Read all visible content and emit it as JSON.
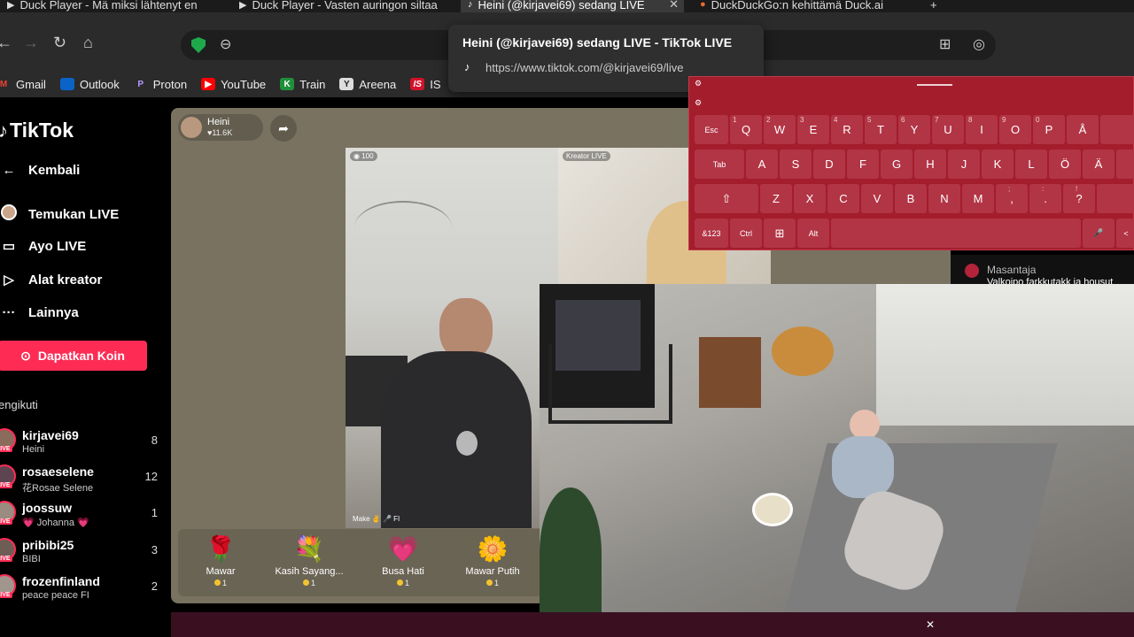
{
  "tabs": [
    {
      "icon": "▶",
      "title": "Duck Player - Mä miksi lähtenyt en"
    },
    {
      "icon": "▶",
      "title": "Duck Player - Vasten auringon siltaa"
    },
    {
      "icon": "♪",
      "title": "Heini (@kirjavei69) sedang LIVE"
    },
    {
      "icon": "●",
      "title": "DuckDuckGo:n kehittämä Duck.ai"
    }
  ],
  "tooltip": {
    "title": "Heini (@kirjavei69) sedang LIVE - TikTok LIVE",
    "url": "https://www.tiktok.com/@kirjavei69/live"
  },
  "bookmarks": [
    {
      "label": "Gmail",
      "icon": "M",
      "color": "#ea4335"
    },
    {
      "label": "Outlook",
      "icon": "■",
      "color": "#0a64c8"
    },
    {
      "label": "Proton",
      "icon": "P",
      "color": "#6d4aff"
    },
    {
      "label": "YouTube",
      "icon": "▶",
      "color": "#ff0000"
    },
    {
      "label": "Train",
      "icon": "K",
      "color": "#1f8f3a"
    },
    {
      "label": "Areena",
      "icon": "Y",
      "color": "#444444"
    },
    {
      "label": "IS",
      "icon": "IS",
      "color": "#d4112a"
    }
  ],
  "sidebar": {
    "logo": "TikTok",
    "nav": [
      {
        "label": "Kembali"
      },
      {
        "label": "Temukan LIVE"
      },
      {
        "label": "Ayo LIVE"
      },
      {
        "label": "Alat kreator"
      },
      {
        "label": "Lainnya"
      }
    ],
    "coin_button": "Dapatkan Koin",
    "following_title": "engikuti",
    "following": [
      {
        "name": "kirjavei69",
        "sub": "Heini",
        "count": "8"
      },
      {
        "name": "rosaeselene",
        "sub": "花Rosae Selene",
        "count": "12"
      },
      {
        "name": "joossuw",
        "sub": "💗 Johanna 💗",
        "count": "1"
      },
      {
        "name": "pribibi25",
        "sub": "BIBI",
        "count": "3"
      },
      {
        "name": "frozenfinland",
        "sub": "peace peace FI",
        "count": "2"
      }
    ]
  },
  "live": {
    "host_name": "Heini",
    "host_likes": "♥11.6K",
    "cam1_tag": "100",
    "cam1_caption": "Make ✌ 🎤 FI",
    "cam2_tag": "Kreator LIVE",
    "gifts": [
      {
        "name": "Mawar",
        "cost": "1",
        "icon": "🌹"
      },
      {
        "name": "Kasih Sayang...",
        "cost": "1",
        "icon": "💐"
      },
      {
        "name": "Busa Hati",
        "cost": "1",
        "icon": "💗"
      },
      {
        "name": "Mawar Putih",
        "cost": "1",
        "icon": "🌼"
      }
    ]
  },
  "chat": {
    "user": "Masantaja",
    "message": "Valkoipo farkkutakk ja housut"
  },
  "keyboard": {
    "row1_hints": [
      "1",
      "2",
      "3",
      "4",
      "5",
      "6",
      "7",
      "8",
      "9",
      "0"
    ],
    "row1": [
      "Esc",
      "Q",
      "W",
      "E",
      "R",
      "T",
      "Y",
      "U",
      "I",
      "O",
      "P",
      "Å"
    ],
    "row2": [
      "Tab",
      "A",
      "S",
      "D",
      "F",
      "G",
      "H",
      "J",
      "K",
      "L",
      "Ö",
      "Ä"
    ],
    "row3": [
      "⇧",
      "Z",
      "X",
      "C",
      "V",
      "B",
      "N",
      "M",
      ",",
      ".",
      "?"
    ],
    "row3_hints": [
      ";",
      ":",
      "!"
    ],
    "row4": [
      "&123",
      "Ctrl",
      "⊞",
      "Alt",
      "🎤",
      "<"
    ]
  },
  "colors": {
    "tiktok_pink": "#fe2c55",
    "keyboard_red": "#a31d2c",
    "panel_bg": "#797261"
  }
}
